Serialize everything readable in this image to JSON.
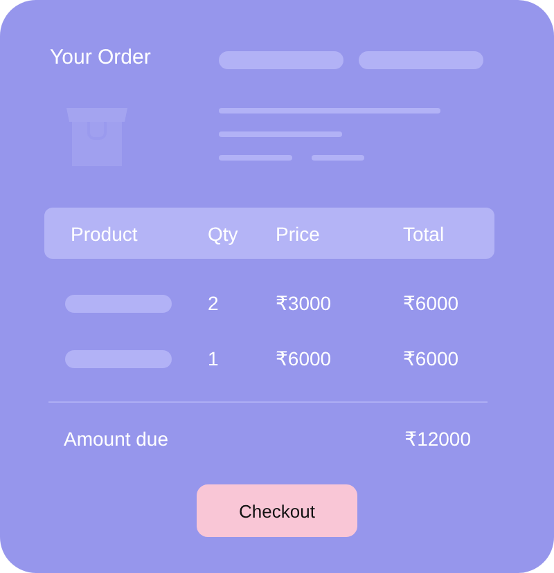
{
  "title": "Your Order",
  "table": {
    "columns": [
      "Product",
      "Qty",
      "Price",
      "Total"
    ],
    "rows": [
      {
        "qty": "2",
        "price": "₹3000",
        "total": "₹6000"
      },
      {
        "qty": "1",
        "price": "₹6000",
        "total": "₹6000"
      }
    ]
  },
  "summary": {
    "label": "Amount due",
    "value": "₹12000"
  },
  "button": "Checkout"
}
